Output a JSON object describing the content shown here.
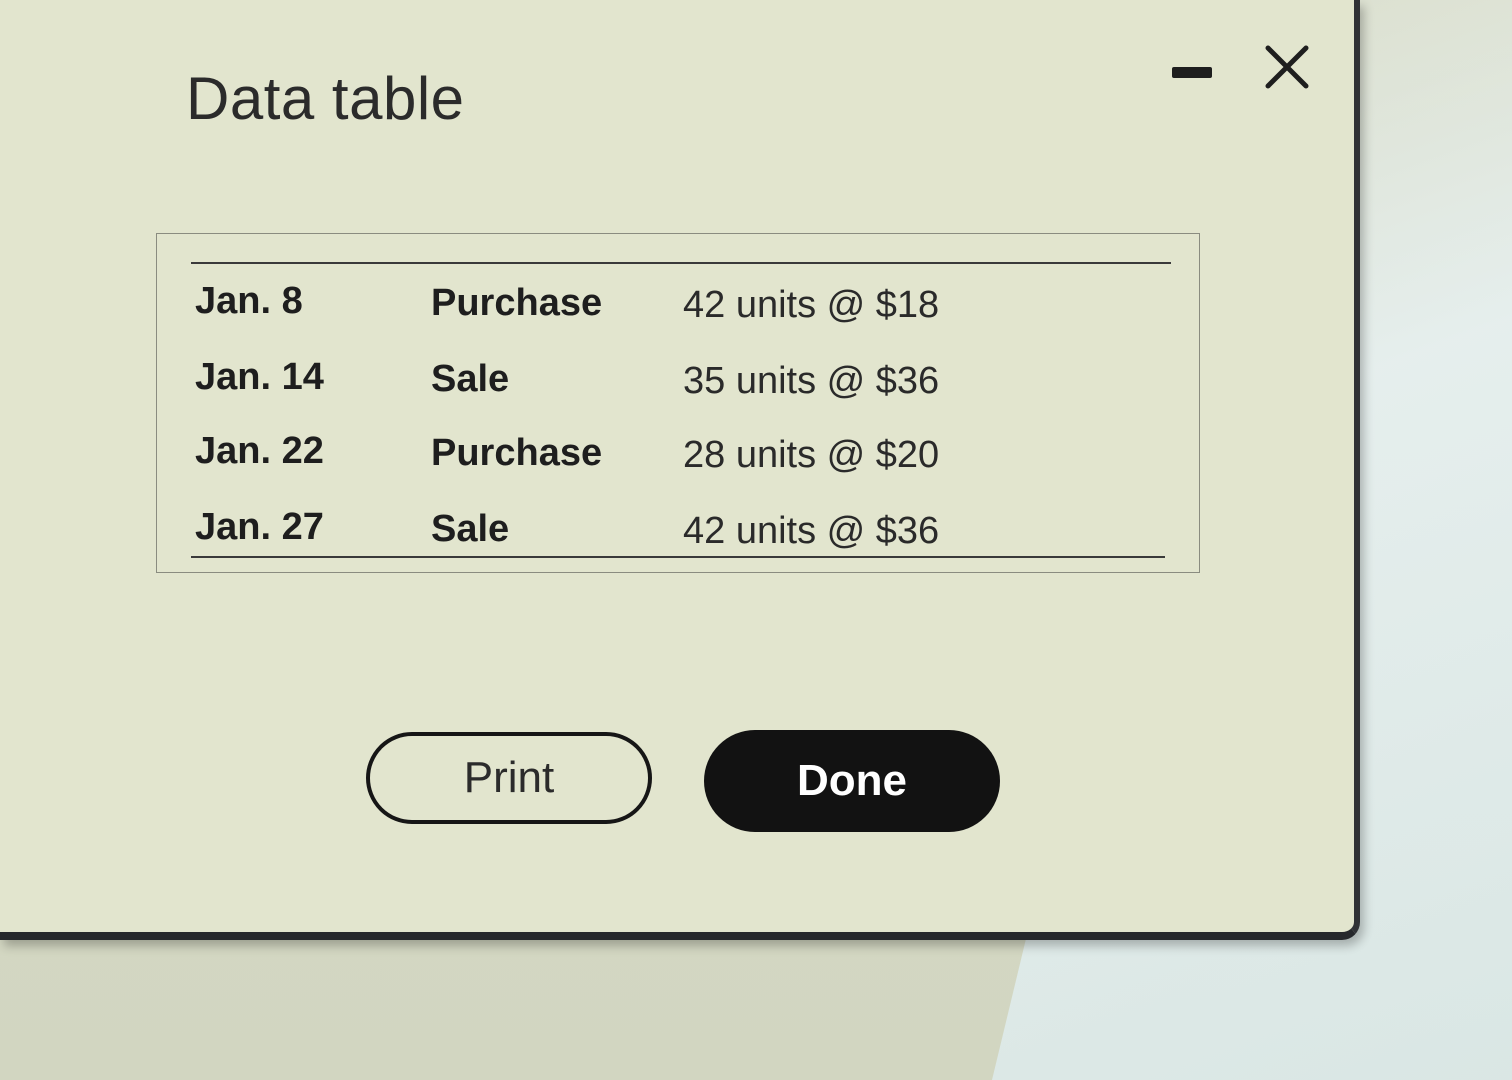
{
  "dialog": {
    "title": "Data table",
    "minimize_icon": "minimize-icon",
    "close_icon": "close-icon"
  },
  "table": {
    "rows": [
      {
        "date": "Jan. 8",
        "type": "Purchase",
        "quantity": "42 units @ $18"
      },
      {
        "date": "Jan. 14",
        "type": "Sale",
        "quantity": "35 units @ $36"
      },
      {
        "date": "Jan. 22",
        "type": "Purchase",
        "quantity": "28 units @ $20"
      },
      {
        "date": "Jan. 27",
        "type": "Sale",
        "quantity": "42 units @ $36"
      }
    ]
  },
  "buttons": {
    "print_label": "Print",
    "done_label": "Done"
  },
  "colors": {
    "dialog_background": "#e2e5ce",
    "done_button_background": "#121212",
    "text": "#1e1e1e"
  }
}
